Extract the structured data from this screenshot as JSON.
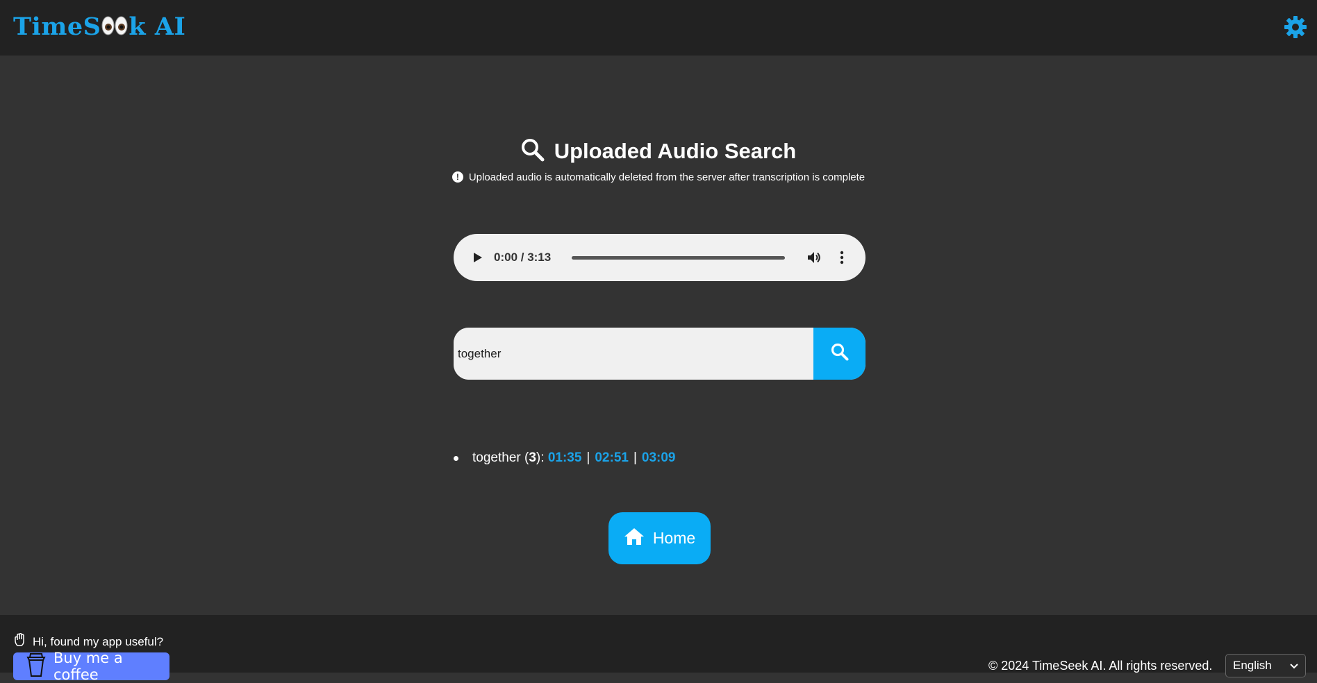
{
  "header": {
    "logo_part1": "TimeS",
    "logo_part2": "k AI",
    "logo_color": "#1ba3e8",
    "settings_icon": "gear-icon"
  },
  "page": {
    "title": "Uploaded Audio Search",
    "notice": "Uploaded audio is automatically deleted from the server after transcription is complete"
  },
  "player": {
    "time": "0:00 / 3:13",
    "progress": 0
  },
  "search": {
    "value": "together"
  },
  "results": [
    {
      "word": "together",
      "count": "3",
      "timestamps": [
        "01:35",
        "02:51",
        "03:09"
      ]
    }
  ],
  "home_button": {
    "label": "Home"
  },
  "footer": {
    "greeting": "Hi, found my app useful?",
    "coffee_label": "Buy me a coffee",
    "copyright": "© 2024 TimeSeek AI. All rights reserved.",
    "language": "English"
  },
  "colors": {
    "accent": "#0aacf5",
    "link": "#1ba3e8",
    "background": "#333333",
    "bar": "#222222",
    "coffee": "#5f7fff"
  }
}
